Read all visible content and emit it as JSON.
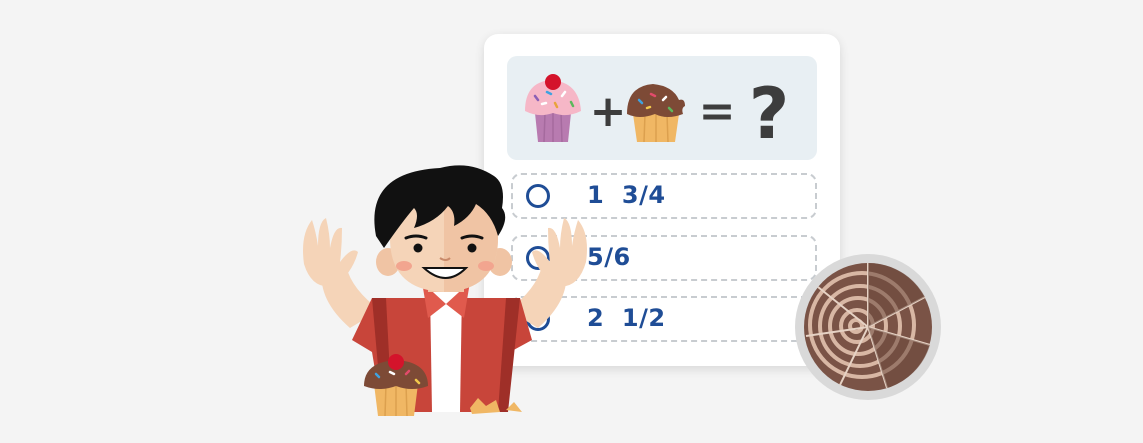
{
  "colors": {
    "background": "#f4f4f4",
    "card": "#ffffff",
    "question_panel": "#e8eff3",
    "option_text": "#1f4d96",
    "operator": "#3d3d3d",
    "shirt": "#c8453a",
    "skin": "#f5d4b8",
    "hair": "#111111"
  },
  "question": {
    "left_operand_icon": "pink-frosted-cupcake-icon",
    "operator_plus": "+",
    "right_operand_icon": "bitten-chocolate-cupcake-icon",
    "operator_equals": "=",
    "result": "?"
  },
  "options": [
    {
      "label": "1  3/4"
    },
    {
      "label": "5/6"
    },
    {
      "label": "2  1/2"
    }
  ],
  "decor": {
    "character_icon": "boy-raising-hands-icon",
    "held_item_icon": "chocolate-cupcake-icon",
    "disc_icon": "wood-slice-pie-icon"
  }
}
